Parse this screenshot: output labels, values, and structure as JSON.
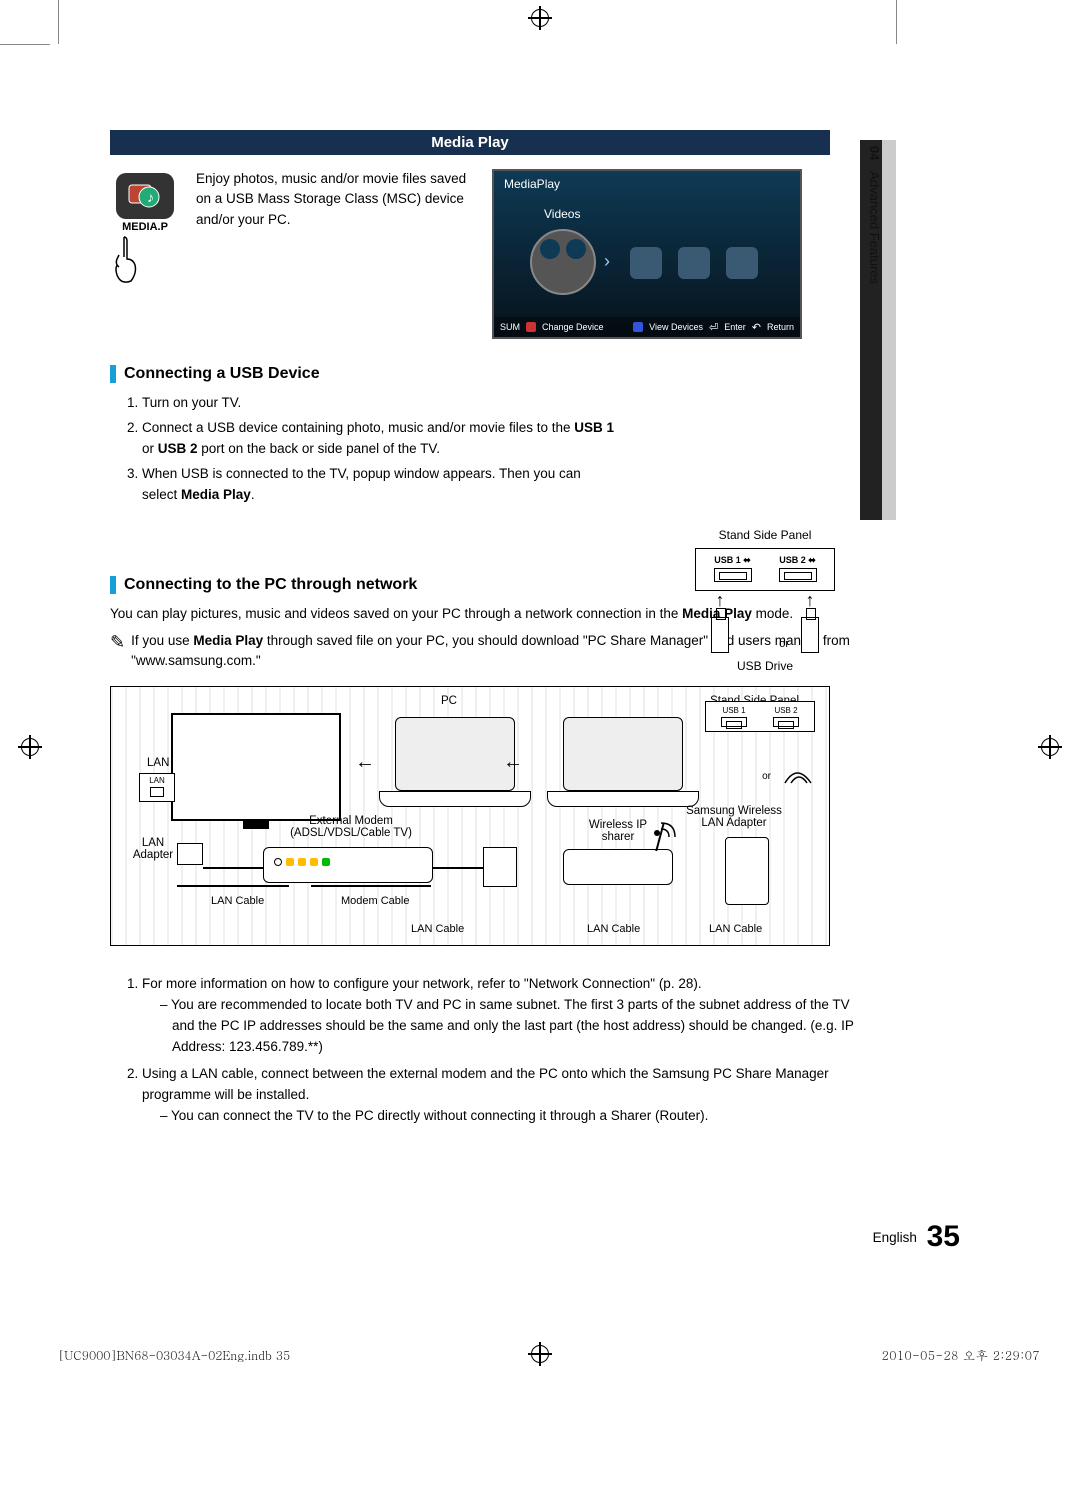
{
  "side_tab": {
    "chapter_num": "04",
    "chapter_title": "Advanced Features"
  },
  "header": {
    "title": "Media Play"
  },
  "intro": {
    "text": "Enjoy photos, music and/or movie files saved on a USB Mass Storage Class (MSC) device and/or your PC.",
    "remote_label": "MEDIA.P"
  },
  "tv": {
    "title": "MediaPlay",
    "item1": "Videos",
    "sum": "SUM",
    "change": "Change Device",
    "view": "View Devices",
    "enter": "Enter",
    "return": "Return"
  },
  "section1": {
    "title": "Connecting a USB Device",
    "steps": [
      "Turn on your TV.",
      "Connect a USB device containing photo, music and/or movie files to the USB 1 or USB 2 port on the back or side panel of the TV.",
      "When USB is connected to the TV, popup window appears. Then you can select Media Play."
    ],
    "step2_b1": "USB 1",
    "step2_b2": "USB 2",
    "step3_b": "Media Play"
  },
  "stand": {
    "title": "Stand Side Panel",
    "usb1": "USB 1",
    "usb2": "USB 2",
    "or": "or",
    "drive": "USB Drive"
  },
  "section2": {
    "title": "Connecting to the PC through network",
    "para": "You can play pictures, music and videos saved on your PC through a network connection in the Media Play mode.",
    "para_b": "Media Play",
    "note": "If you use Media Play through saved file on your PC, you should download \"PC Share Manager\" and users manual from \"www.samsung.com.\"",
    "note_b": "Media Play"
  },
  "diagram": {
    "pc": "PC",
    "stand": "Stand Side Panel",
    "lan": "LAN",
    "lan_adapter_l": "LAN Adapter",
    "ext_modem1": "External Modem",
    "ext_modem2": "(ADSL/VDSL/Cable TV)",
    "wireless1": "Wireless IP",
    "wireless2": "sharer",
    "adapter1": "Samsung Wireless",
    "adapter2": "LAN Adapter",
    "or": "or",
    "lan_cable": "LAN Cable",
    "modem_cable": "Modem Cable",
    "usb1": "USB 1",
    "usb2": "USB 2"
  },
  "section3": {
    "steps": [
      "For more information on how to configure your network, refer to \"Network Connection\" (p. 28).",
      "Using a LAN cable, connect between the external modem and the PC onto which the Samsung PC Share Manager programme will be installed."
    ],
    "sub1": "You are recommended to locate both TV and PC in same subnet. The first 3 parts of the subnet address of the TV and the PC IP addresses should be the same and only the last part (the host address) should be changed. (e.g. IP Address: 123.456.789.**)",
    "sub2": "You can connect the TV to the PC directly without connecting it through a Sharer (Router)."
  },
  "footer": {
    "lang": "English",
    "page": "35",
    "print_left": "[UC9000]BN68-03034A-02Eng.indb   35",
    "print_right": "2010-05-28   오후 2:29:07"
  }
}
